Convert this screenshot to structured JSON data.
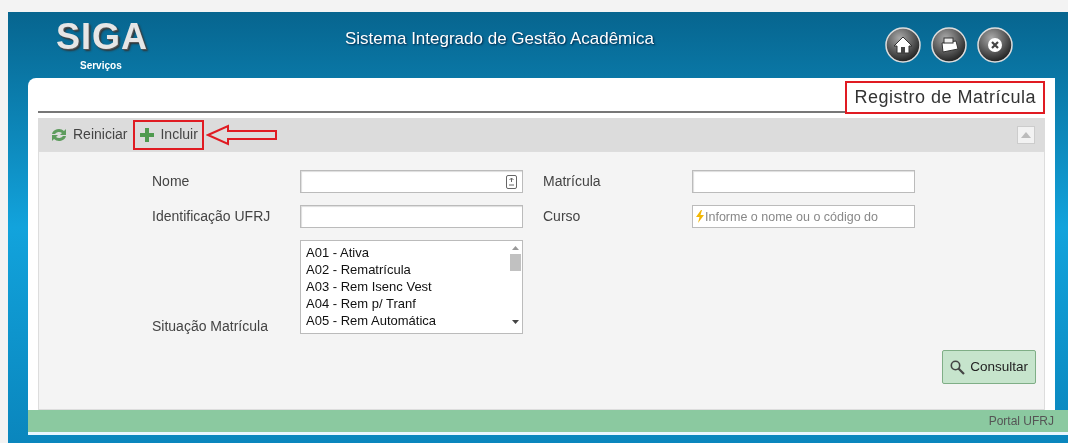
{
  "header": {
    "logo": "SIGA",
    "logo_subtitle": "Serviços",
    "title": "Sistema Integrado de Gestão Acadêmica",
    "buttons": [
      {
        "kind": "home"
      },
      {
        "kind": "print"
      },
      {
        "kind": "close"
      }
    ]
  },
  "page_title": {
    "text": "Registro de Matrícula",
    "highlighted": true
  },
  "toolbar": {
    "items": [
      {
        "label": "Reiniciar",
        "kind": "refresh",
        "highlighted": false,
        "pointer_arrow": false
      },
      {
        "label": "Incluir",
        "kind": "add",
        "highlighted": true,
        "pointer_arrow": true
      }
    ],
    "collapse_button": true
  },
  "form": {
    "fields": [
      {
        "label": "Nome",
        "kind": "text",
        "trailing_icon": true
      },
      {
        "label": "Matrícula",
        "kind": "text",
        "trailing_icon": false
      },
      {
        "label": "Identificação UFRJ",
        "kind": "text",
        "trailing_icon": false
      },
      {
        "label": "Curso",
        "kind": "autocomplete",
        "placeholder": "Informe o nome ou o código do"
      },
      {
        "label": "Situação Matrícula",
        "kind": "listbox",
        "options": [
          {
            "text": "A01 - Ativa",
            "selected": false
          },
          {
            "text": "A02 - Rematrícula",
            "selected": false
          },
          {
            "text": "A03 - Rem Isenc Vest",
            "selected": false
          },
          {
            "text": "A04 - Rem p/ Tranf",
            "selected": false
          },
          {
            "text": "A05 - Rem Automática",
            "selected": false
          }
        ]
      }
    ],
    "submit": "Consultar"
  },
  "footer": {
    "link": "Portal UFRJ"
  }
}
